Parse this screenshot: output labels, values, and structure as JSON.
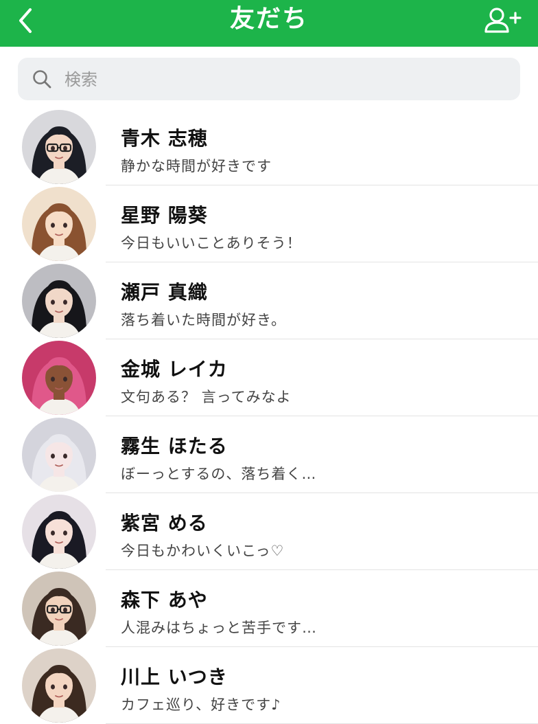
{
  "header": {
    "title": "友だち",
    "back_icon": "chevron-left-icon",
    "add_icon": "add-friend-icon",
    "bg_color": "#1db44a"
  },
  "search": {
    "placeholder": "検索",
    "value": "",
    "icon": "search-icon"
  },
  "friends": [
    {
      "name": "青木 志穂",
      "status": "静かな時間が好きです",
      "hair": "#1c1e26",
      "skin": "#f3d6c4",
      "bg": "#d8d8dc",
      "glasses": true
    },
    {
      "name": "星野 陽葵",
      "status": "今日もいいことありそう！",
      "hair": "#8a5230",
      "skin": "#f7dcc6",
      "bg": "#f0e0cc",
      "glasses": false
    },
    {
      "name": "瀬戸 真織",
      "status": "落ち着いた時間が好き。",
      "hair": "#16161a",
      "skin": "#f1d8c8",
      "bg": "#bdbdc2",
      "glasses": false
    },
    {
      "name": "金城 レイカ",
      "status": "文句ある？ 言ってみなよ",
      "hair": "#e0588a",
      "skin": "#8a5236",
      "bg": "#c73a6a",
      "glasses": false
    },
    {
      "name": "霧生 ほたる",
      "status": "ぼーっとするの、落ち着く…",
      "hair": "#e8e8ee",
      "skin": "#f6e6e6",
      "bg": "#d4d4dc",
      "glasses": false
    },
    {
      "name": "紫宮 める",
      "status": "今日もかわいくいこっ♡",
      "hair": "#1a1a24",
      "skin": "#f7e0d8",
      "bg": "#e6e0e6",
      "glasses": false
    },
    {
      "name": "森下 あや",
      "status": "人混みはちょっと苦手です…",
      "hair": "#3a2a22",
      "skin": "#f1d2bc",
      "bg": "#cfc4b8",
      "glasses": true
    },
    {
      "name": "川上 いつき",
      "status": "カフェ巡り、好きです♪",
      "hair": "#3c2a20",
      "skin": "#f4d6c2",
      "bg": "#ddd2c8",
      "glasses": false
    }
  ]
}
